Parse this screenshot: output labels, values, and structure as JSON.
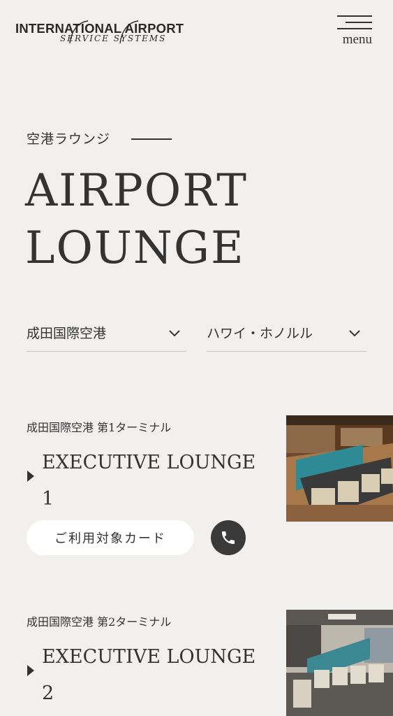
{
  "header": {
    "logo_line1": "INTERNATIONAL AIRPORT",
    "logo_line2": "SERVICE SYSTEMS",
    "menu_label": "menu"
  },
  "hero": {
    "subtitle": "空港ラウンジ",
    "title_line1": "AIRPORT",
    "title_line2": "LOUNGE"
  },
  "filters": {
    "airport": "成田国際空港",
    "destination": "ハワイ・ホノルル"
  },
  "lounges": [
    {
      "location": "成田国際空港 第1ターミナル",
      "name": "EXECUTIVE LOUNGE 1",
      "card_button": "ご利用対象カード"
    },
    {
      "location": "成田国際空港 第2ターミナル",
      "name": "EXECUTIVE LOUNGE 2"
    }
  ],
  "colors": {
    "background": "#f1f0ef",
    "text": "#2f2f2f",
    "phone_button": "#3a3a3a",
    "card_button": "#ffffff"
  },
  "icons": [
    "menu-icon",
    "chevron-down-icon",
    "caret-right-icon",
    "phone-icon"
  ]
}
